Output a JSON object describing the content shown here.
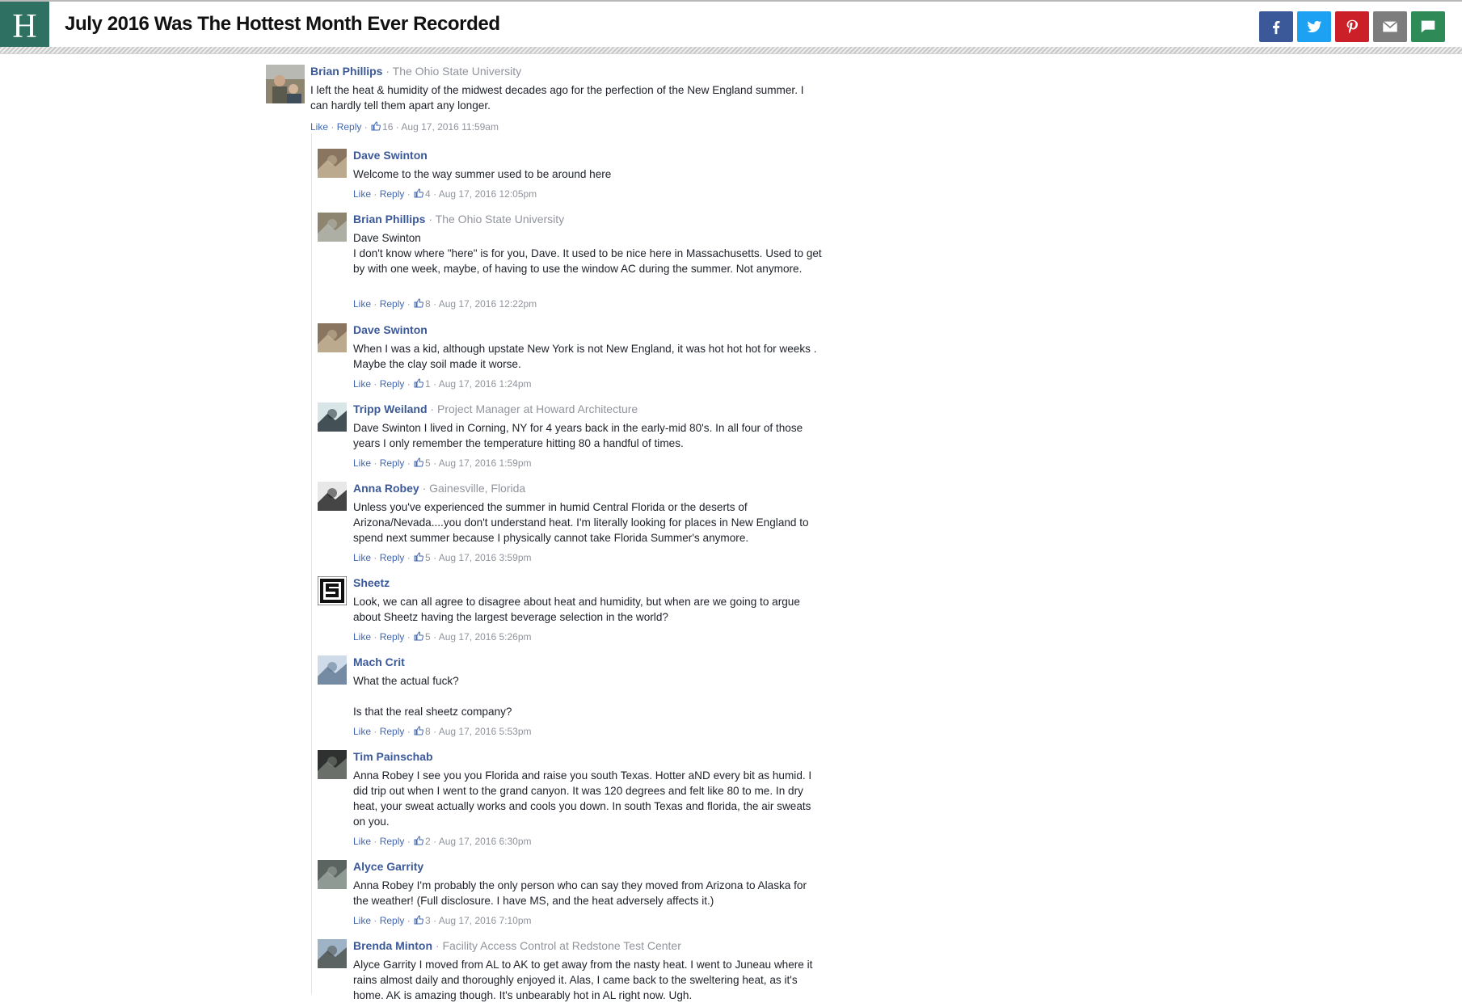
{
  "header": {
    "logo": "H",
    "title": "July 2016 Was The Hottest Month Ever Recorded",
    "share_icons": [
      "facebook-icon",
      "twitter-icon",
      "pinterest-icon",
      "email-icon",
      "comment-icon"
    ],
    "colors": {
      "brand": "#2e7061",
      "facebook": "#3b5998",
      "twitter": "#1da1f2",
      "pinterest": "#cb2027",
      "email": "#7d7d7d",
      "comments": "#2e8b57"
    }
  },
  "labels": {
    "like": "Like",
    "reply": "Reply",
    "sep": " · "
  },
  "root": {
    "author": "Brian Phillips",
    "affiliation": "The Ohio State University",
    "text": "I left the heat & humidity of the midwest decades ago for the perfection of the New England summer. I can hardly tell them apart any longer.",
    "likes": "16",
    "time": "Aug 17, 2016 11:59am"
  },
  "replies": [
    {
      "author": "Dave Swinton",
      "affiliation": "",
      "text": "Welcome to the way summer used to be around here",
      "likes": "4",
      "time": "Aug 17, 2016 12:05pm"
    },
    {
      "author": "Brian Phillips",
      "affiliation": "The Ohio State University",
      "text": "Dave Swinton\nI don't know where \"here\" is for you, Dave. It used to be nice here in Massachusetts. Used to get by with one week, maybe, of having to use the window AC during the summer. Not anymore.",
      "likes": "8",
      "time": "Aug 17, 2016 12:22pm"
    },
    {
      "author": "Dave Swinton",
      "affiliation": "",
      "text": "When I was a kid, although upstate New York is not New England, it was hot hot hot for weeks . Maybe the clay soil made it worse.",
      "likes": "1",
      "time": "Aug 17, 2016 1:24pm"
    },
    {
      "author": "Tripp Weiland",
      "affiliation": "Project Manager at Howard Architecture",
      "text": "Dave Swinton I lived in Corning, NY for 4 years back in the early-mid 80's. In all four of those years I only remember the temperature hitting 80 a handful of times.",
      "likes": "5",
      "time": "Aug 17, 2016 1:59pm"
    },
    {
      "author": "Anna Robey",
      "affiliation": "Gainesville, Florida",
      "text": "Unless you've experienced the summer in humid Central Florida or the deserts of Arizona/Nevada....you don't understand heat. I'm literally looking for places in New England to spend next summer because I physically cannot take Florida Summer's anymore.",
      "likes": "5",
      "time": "Aug 17, 2016 3:59pm"
    },
    {
      "author": "Sheetz",
      "affiliation": "",
      "text": "Look, we can all agree to disagree about heat and humidity, but when are we going to argue about Sheetz having the largest beverage selection in the world?",
      "likes": "5",
      "time": "Aug 17, 2016 5:26pm"
    },
    {
      "author": "Mach Crit",
      "affiliation": "",
      "text": "What the actual fuck?\n\nIs that the real sheetz company?",
      "likes": "8",
      "time": "Aug 17, 2016 5:53pm"
    },
    {
      "author": "Tim Painschab",
      "affiliation": "",
      "text": "Anna Robey I see you you Florida and raise you south Texas. Hotter aND every bit as humid. I did trip out when I went to the grand canyon. It was 120 degrees and felt like 80 to me. In dry heat, your sweat actually works and cools you down. In south Texas and florida, the air sweats on you.",
      "likes": "2",
      "time": "Aug 17, 2016 6:30pm"
    },
    {
      "author": "Alyce Garrity",
      "affiliation": "",
      "text": "Anna Robey I'm probably the only person who can say they moved from Arizona to Alaska for the weather! (Full disclosure. I have MS, and the heat adversely affects it.)",
      "likes": "3",
      "time": "Aug 17, 2016 7:10pm"
    },
    {
      "author": "Brenda Minton",
      "affiliation": "Facility Access Control at Redstone Test Center",
      "text": "Alyce Garrity I moved from AL to AK to get away from the nasty heat. I went to Juneau where it rains almost daily and thoroughly enjoyed it. Alas, I came back to the sweltering heat, as it's home. AK is amazing though. It's unbearably hot in AL right now. Ugh.",
      "likes": "",
      "time": ""
    }
  ]
}
